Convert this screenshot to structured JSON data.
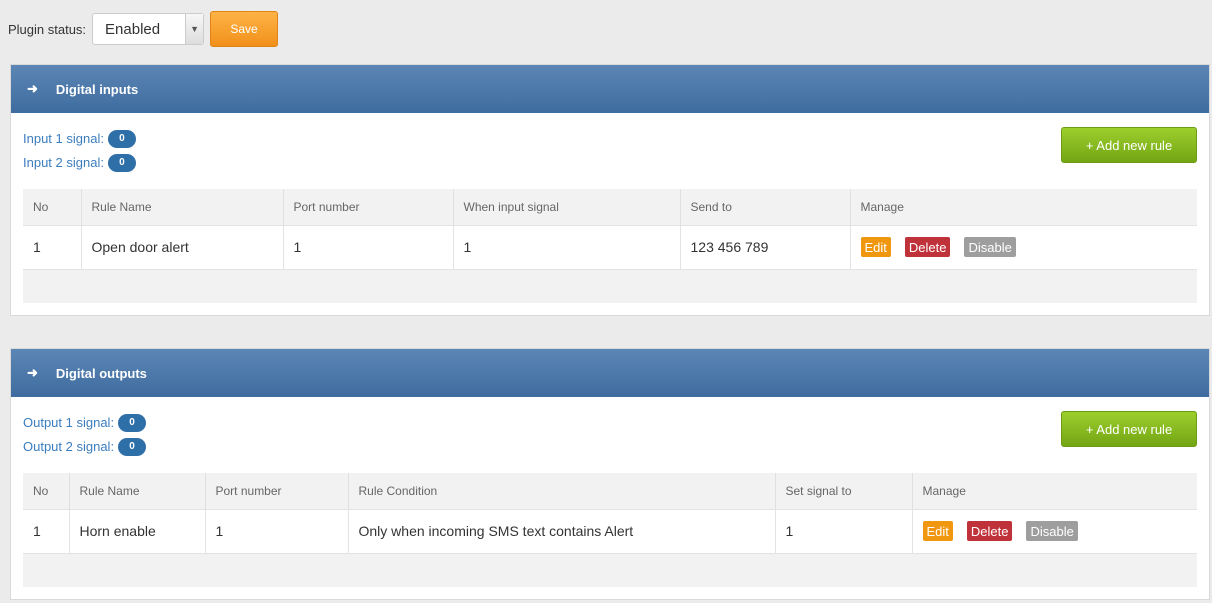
{
  "plugin": {
    "status_label": "Plugin status:",
    "status_value": "Enabled",
    "save_label": "Save"
  },
  "inputs": {
    "title": "Digital inputs",
    "add_label": "+ Add new rule",
    "signals": [
      {
        "label": "Input 1 signal:",
        "value": "0"
      },
      {
        "label": "Input 2 signal:",
        "value": "0"
      }
    ],
    "columns": [
      "No",
      "Rule Name",
      "Port number",
      "When input signal",
      "Send to",
      "Manage"
    ],
    "rows": [
      {
        "no": "1",
        "name": "Open door alert",
        "port": "1",
        "cond": "1",
        "target": "123 456 789"
      }
    ]
  },
  "outputs": {
    "title": "Digital outputs",
    "add_label": "+ Add new rule",
    "signals": [
      {
        "label": "Output 1 signal:",
        "value": "0"
      },
      {
        "label": "Output 2 signal:",
        "value": "0"
      }
    ],
    "columns": [
      "No",
      "Rule Name",
      "Port number",
      "Rule Condition",
      "Set signal to",
      "Manage"
    ],
    "rows": [
      {
        "no": "1",
        "name": "Horn enable",
        "port": "1",
        "cond": "Only when incoming SMS text contains Alert",
        "target": "1"
      }
    ]
  },
  "actions": {
    "edit": "Edit",
    "delete": "Delete",
    "disable": "Disable"
  },
  "colors": {
    "header": "#4a77a8",
    "save": "#f7a13b",
    "add": "#8bbd1f",
    "edit": "#f0960f",
    "delete": "#c0323a",
    "disable": "#9e9e9e",
    "badge": "#2f6fa8"
  }
}
